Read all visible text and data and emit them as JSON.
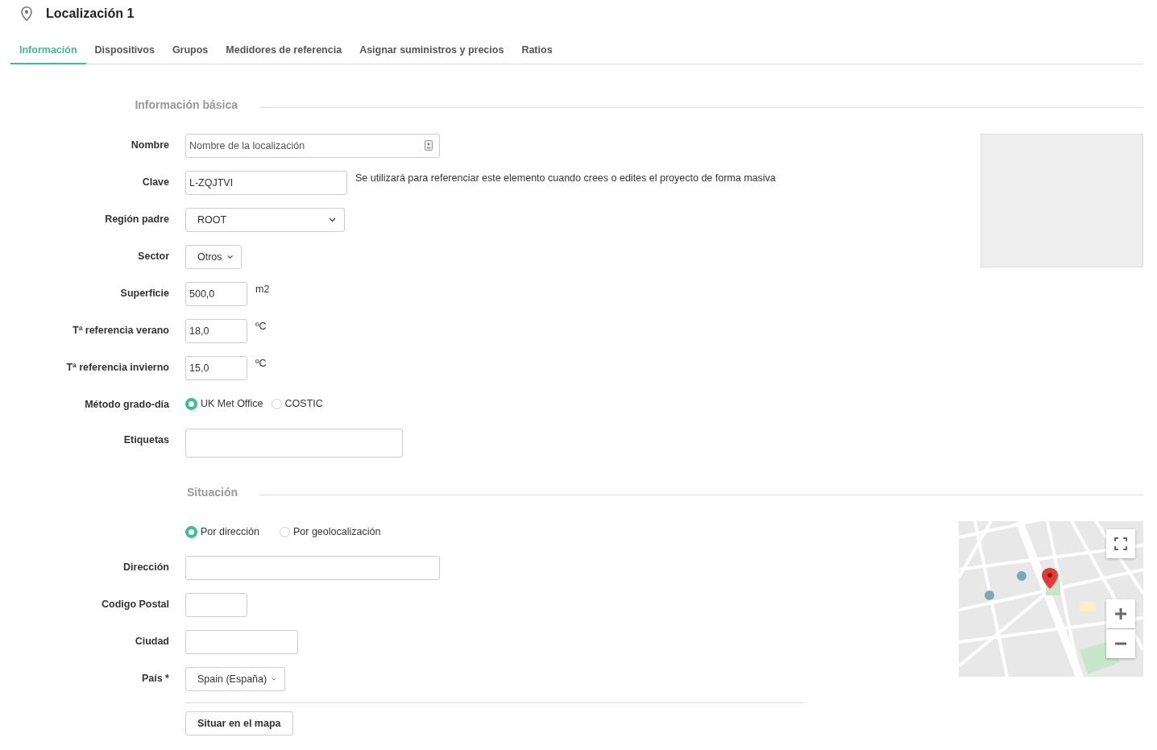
{
  "header": {
    "title": "Localización 1"
  },
  "tabs": [
    {
      "label": "Información",
      "selected": true
    },
    {
      "label": "Dispositivos",
      "selected": false
    },
    {
      "label": "Grupos",
      "selected": false
    },
    {
      "label": "Medidores de referencia",
      "selected": false
    },
    {
      "label": "Asignar suministros y precios",
      "selected": false
    },
    {
      "label": "Ratios",
      "selected": false
    }
  ],
  "sections": [
    {
      "title": "Información básica",
      "side": {
        "kind": "image_box"
      },
      "fields": [
        {
          "kind": "text",
          "label": "Nombre",
          "placeholder": "Nombre de la localización",
          "icon": true
        },
        {
          "kind": "text",
          "label": "Clave",
          "value": "L-ZQJTVI",
          "hint": "Se utilizará para referenciar este elemento cuando crees o edites el proyecto de forma masiva"
        },
        {
          "kind": "select",
          "label": "Región padre",
          "value": "ROOT"
        },
        {
          "kind": "select",
          "label": "Sector",
          "value": "Otros"
        },
        {
          "kind": "text",
          "label": "Superficie",
          "value": "500,0",
          "suffix": "m2"
        },
        {
          "kind": "text",
          "label": "Tª referencia verano",
          "value": "18,0",
          "suffix": "ºC"
        },
        {
          "kind": "text",
          "label": "Tª referencia invierno",
          "value": "15,0",
          "suffix": "ºC"
        },
        {
          "kind": "radio",
          "label": "Método grado-día",
          "options": [
            {
              "label": "UK Met Office",
              "selected": true
            },
            {
              "label": "COSTIC",
              "selected": false
            }
          ]
        },
        {
          "kind": "tags",
          "label": "Etiquetas"
        }
      ]
    },
    {
      "title": "Situación",
      "side": {
        "kind": "map"
      },
      "fields": [
        {
          "kind": "radio",
          "options": [
            {
              "label": "Por dirección",
              "selected": true
            },
            {
              "label": "Por geolocalización",
              "selected": false
            }
          ]
        },
        {
          "kind": "text",
          "label": "Dirección"
        },
        {
          "kind": "text",
          "label": "Codigo Postal"
        },
        {
          "kind": "text",
          "label": "Ciudad"
        },
        {
          "kind": "select",
          "label": "País *",
          "value": "Spain (España)"
        },
        {
          "kind": "button",
          "label": "Situar en el mapa"
        }
      ]
    }
  ]
}
